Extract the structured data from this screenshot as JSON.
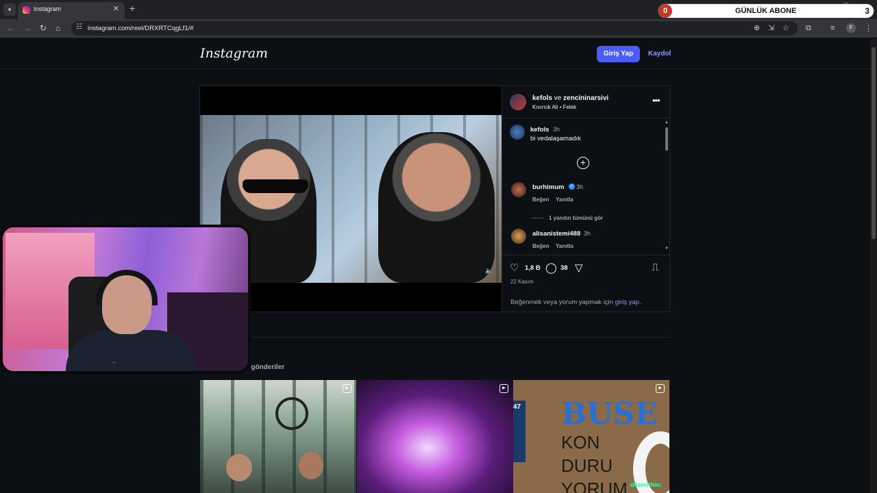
{
  "browser": {
    "tab_title": "Instagram",
    "url": "instagram.com/reel/DRXRTCqgLf1/#",
    "profile_initial": "E"
  },
  "subscriber_widget": {
    "count": "0",
    "label": "GÜNLÜK ABONE",
    "goal": "3"
  },
  "header": {
    "logo": "Instagram",
    "login_label": "Giriş Yap",
    "signup_label": "Kaydol"
  },
  "post": {
    "author": "kefols",
    "and_text": "ve",
    "collaborator": "zencininarsivi",
    "music": "Kıvırcık Ali • Felek",
    "caption": {
      "user": "kefols",
      "time": "3h",
      "text": "bi vedalaşamadık"
    },
    "comments": [
      {
        "user": "burhimum",
        "verified": true,
        "time": "3h",
        "like": "Beğen",
        "reply": "Yanıtla"
      },
      {
        "user": "alisanistemi488",
        "verified": false,
        "time": "3h",
        "like": "Beğen",
        "reply": "Yanıtla"
      }
    ],
    "view_replies": "1 yanıtın tümünü gör",
    "likes": "1,8 B",
    "comments_count": "38",
    "date": "22 Kasım",
    "login_prompt_prefix": "Beğenmek veya yorum yapmak için",
    "login_prompt_link": "giriş yap",
    "login_prompt_suffix": "."
  },
  "more_posts": {
    "heading": "ger gönderiler",
    "thumbs": [
      {
        "kind": "reel"
      },
      {
        "kind": "reel"
      },
      {
        "kind": "reel",
        "tag": "47",
        "line1": "BUSE",
        "line2": "KON",
        "line3": "DURU",
        "line4": "YORUM"
      }
    ]
  },
  "chat_overlay": "dilenothin:",
  "colors": {
    "accent": "#4a5df9",
    "link": "#8c9bff",
    "background": "#0c1014"
  }
}
